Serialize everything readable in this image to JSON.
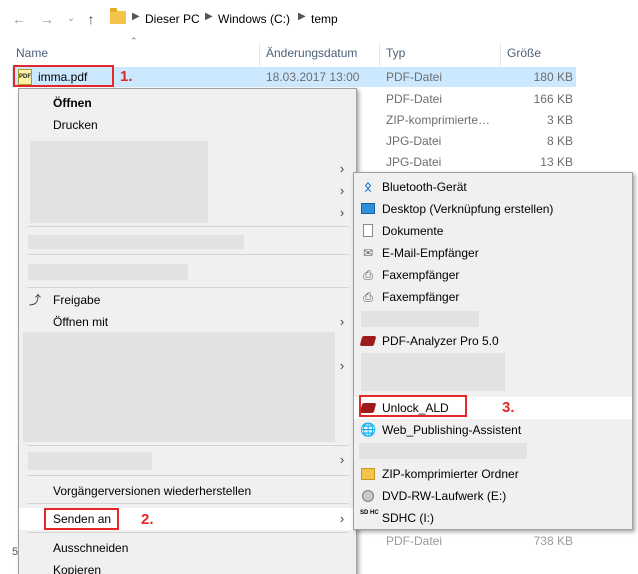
{
  "address": {
    "breadcrumbs": [
      "Dieser PC",
      "Windows (C:)",
      "temp"
    ]
  },
  "columns": {
    "name": "Name",
    "date": "Änderungsdatum",
    "type": "Typ",
    "size": "Größe"
  },
  "files": [
    {
      "name": "imma.pdf",
      "date": "18.03.2017 13:00",
      "type": "PDF-Datei",
      "size": "180 KB"
    },
    {
      "name": "",
      "date": "",
      "type": "PDF-Datei",
      "size": "166 KB"
    },
    {
      "name": "",
      "date": "",
      "type": "ZIP-komprimierte…",
      "size": "3 KB"
    },
    {
      "name": "",
      "date": "",
      "type": "JPG-Datei",
      "size": "8 KB"
    },
    {
      "name": "",
      "date": "",
      "type": "JPG-Datei",
      "size": "13 KB"
    },
    {
      "name": "",
      "date": "",
      "type": "PDF-Datei",
      "size": "738 KB"
    }
  ],
  "status": {
    "left_digit": "5"
  },
  "context_menu": {
    "open": "Öffnen",
    "print": "Drucken",
    "share": "Freigabe",
    "open_with": "Öffnen mit",
    "restore": "Vorgängerversionen wiederherstellen",
    "send_to": "Senden an",
    "cut": "Ausschneiden",
    "copy": "Kopieren"
  },
  "send_to_menu": [
    {
      "label": "Bluetooth-Gerät",
      "icon": "bluetooth-icon"
    },
    {
      "label": "Desktop (Verknüpfung erstellen)",
      "icon": "desktop-icon"
    },
    {
      "label": "Dokumente",
      "icon": "documents-icon"
    },
    {
      "label": "E-Mail-Empfänger",
      "icon": "mail-icon"
    },
    {
      "label": "Faxempfänger",
      "icon": "fax-icon"
    },
    {
      "label": "Faxempfänger",
      "icon": "fax-icon"
    },
    {
      "label": "PDF-Analyzer Pro 5.0",
      "icon": "pdf-analyzer-icon"
    },
    {
      "label": "Unlock_ALD",
      "icon": "unlock-ald-icon"
    },
    {
      "label": "Web_Publishing-Assistent",
      "icon": "web-publishing-icon"
    },
    {
      "label": "ZIP-komprimierter Ordner",
      "icon": "zip-folder-icon"
    },
    {
      "label": "DVD-RW-Laufwerk (E:)",
      "icon": "dvd-drive-icon"
    },
    {
      "label": "SDHC (I:)",
      "icon": "sd-card-icon"
    }
  ],
  "annotations": {
    "step1": "1.",
    "step2": "2.",
    "step3": "3."
  },
  "pdf_icon_text": "PDF",
  "sd_icon_text": "SD HC",
  "colors": {
    "selection": "#cce8ff",
    "annotation_red": "#e52727",
    "menu_bg": "#f0f0f0"
  }
}
